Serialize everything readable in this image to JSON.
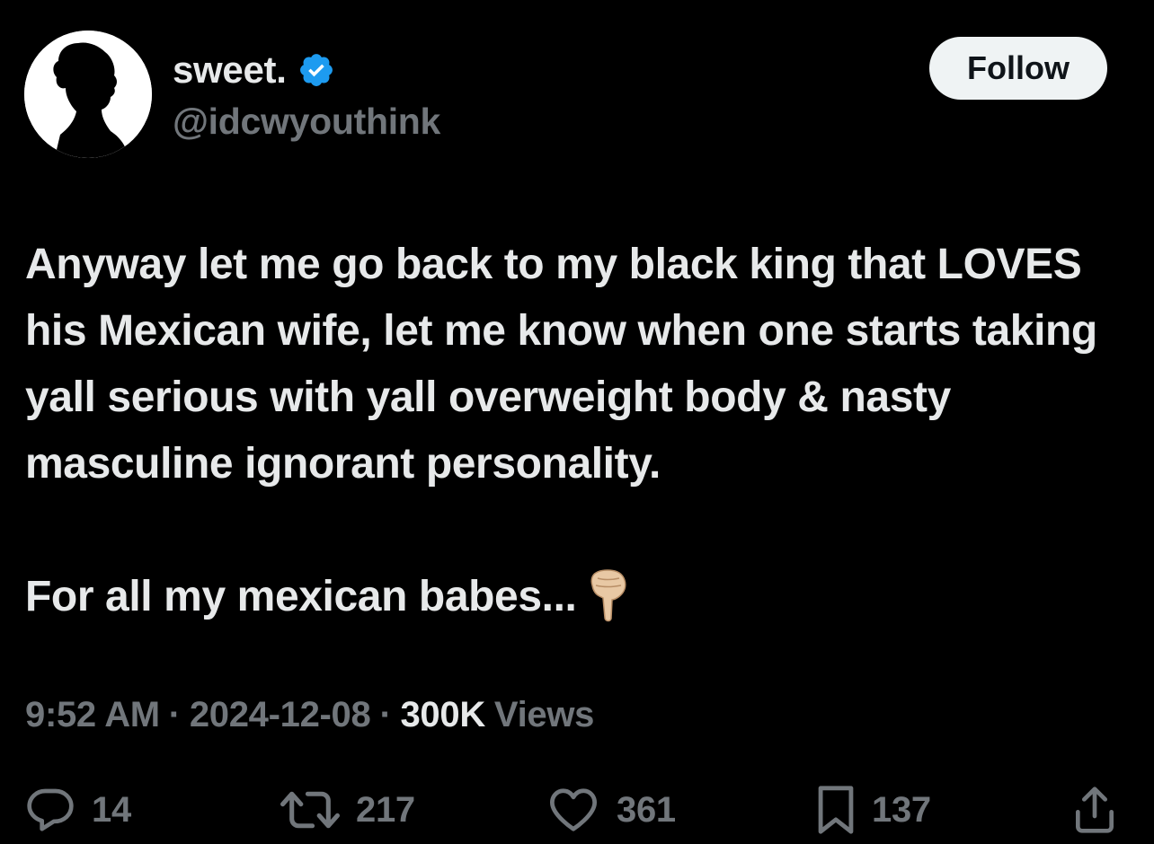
{
  "author": {
    "display_name": "sweet.",
    "handle": "@idcwyouthink",
    "verified": true,
    "verified_color": "#1d9bf0",
    "avatar_icon": "silhouette-profile"
  },
  "follow_button": {
    "label": "Follow"
  },
  "tweet": {
    "paragraph_1": "Anyway let me go back to my black king that LOVES his Mexican wife, let me know when one starts taking yall serious with yall overweight body & nasty masculine ignorant personality.",
    "paragraph_2": "For all my mexican babes...",
    "emoji_icon": "backhand-index-pointing-down"
  },
  "meta": {
    "time": "9:52 AM",
    "separator": "·",
    "date": "2024-12-08",
    "views_count": "300K",
    "views_label": "Views"
  },
  "actions": {
    "replies": "14",
    "reposts": "217",
    "likes": "361",
    "bookmarks": "137"
  },
  "colors": {
    "background": "#000000",
    "text": "#e7e9ea",
    "secondary_text": "#71767b",
    "follow_button_bg": "#eff3f4"
  }
}
